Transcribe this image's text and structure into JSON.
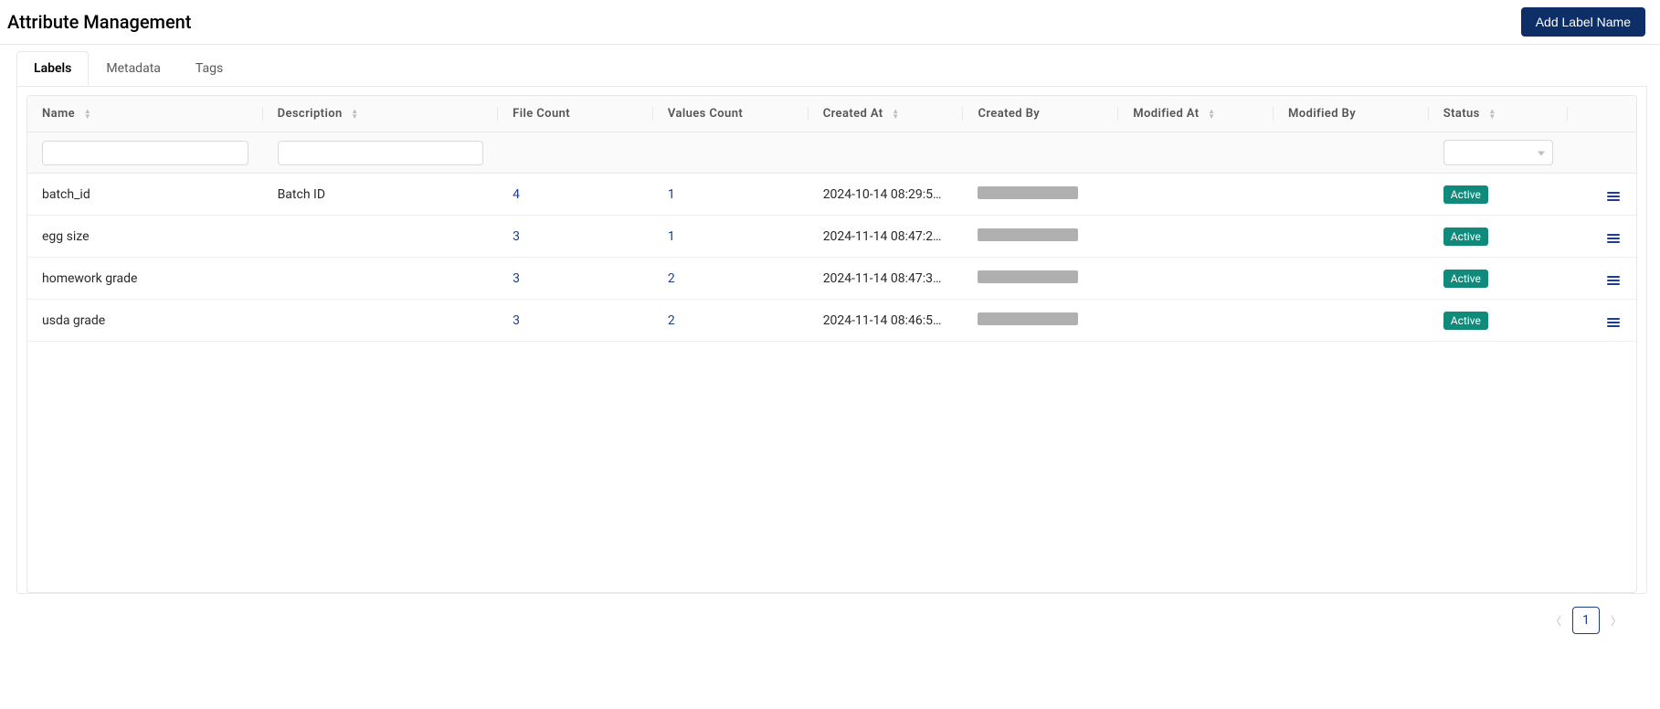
{
  "header": {
    "title": "Attribute Management",
    "add_button": "Add Label Name"
  },
  "tabs": [
    {
      "label": "Labels",
      "active": true
    },
    {
      "label": "Metadata",
      "active": false
    },
    {
      "label": "Tags",
      "active": false
    }
  ],
  "columns": {
    "name": "Name",
    "description": "Description",
    "file_count": "File Count",
    "values_count": "Values Count",
    "created_at": "Created At",
    "created_by": "Created By",
    "modified_at": "Modified At",
    "modified_by": "Modified By",
    "status": "Status"
  },
  "filters": {
    "name": "",
    "description": "",
    "status": ""
  },
  "rows": [
    {
      "name": "batch_id",
      "description": "Batch ID",
      "file_count": "4",
      "values_count": "1",
      "created_at": "2024-10-14 08:29:5…",
      "created_by_redacted": true,
      "modified_at": "",
      "modified_by": "",
      "status": "Active"
    },
    {
      "name": "egg size",
      "description": "",
      "file_count": "3",
      "values_count": "1",
      "created_at": "2024-11-14 08:47:2…",
      "created_by_redacted": true,
      "modified_at": "",
      "modified_by": "",
      "status": "Active"
    },
    {
      "name": "homework grade",
      "description": "",
      "file_count": "3",
      "values_count": "2",
      "created_at": "2024-11-14 08:47:3…",
      "created_by_redacted": true,
      "modified_at": "",
      "modified_by": "",
      "status": "Active"
    },
    {
      "name": "usda grade",
      "description": "",
      "file_count": "3",
      "values_count": "2",
      "created_at": "2024-11-14 08:46:5…",
      "created_by_redacted": true,
      "modified_at": "",
      "modified_by": "",
      "status": "Active"
    }
  ],
  "pagination": {
    "current": "1"
  }
}
